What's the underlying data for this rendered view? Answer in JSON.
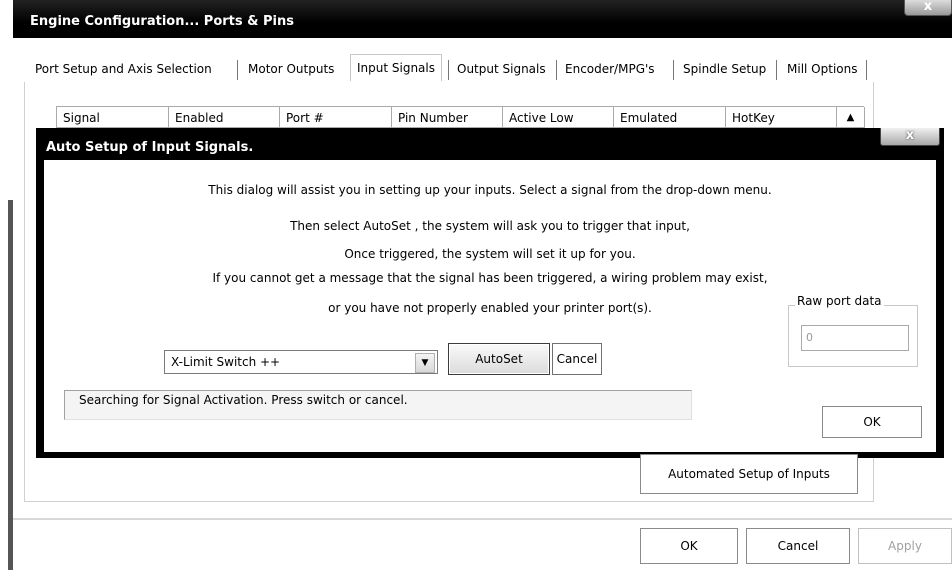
{
  "main_window": {
    "title": "Engine Configuration... Ports & Pins",
    "close_glyph": "x"
  },
  "tabs": [
    {
      "label": "Port Setup and Axis Selection"
    },
    {
      "label": "Motor Outputs"
    },
    {
      "label": "Input Signals",
      "selected": true
    },
    {
      "label": "Output Signals"
    },
    {
      "label": "Encoder/MPG's"
    },
    {
      "label": "Spindle Setup"
    },
    {
      "label": "Mill Options"
    }
  ],
  "table": {
    "columns": [
      "Signal",
      "Enabled",
      "Port #",
      "Pin Number",
      "Active Low",
      "Emulated",
      "HotKey"
    ],
    "scroll_glyph": "▲"
  },
  "dialog": {
    "title": "Auto Setup of Input Signals.",
    "close_glyph": "x",
    "messages": [
      "This dialog will assist you in setting up your inputs. Select a signal from the drop-down menu.",
      "Then select AutoSet , the system will ask you to trigger that input,",
      "Once triggered, the system will set it up for you.",
      "If you cannot get a message that the signal has been triggered, a wiring problem may exist,",
      "or you have not properly enabled your printer port(s)."
    ],
    "signal_select": {
      "value": "X-Limit Switch ++",
      "arrow": "▼"
    },
    "autoset_label": "AutoSet",
    "cancel_label": "Cancel",
    "status_text": "Searching for Signal Activation. Press switch or cancel.",
    "raw_port": {
      "label": "Raw port data",
      "value": "0"
    },
    "ok_label": "OK"
  },
  "footer": {
    "automated_setup_label": "Automated Setup of Inputs",
    "ok_label": "OK",
    "cancel_label": "Cancel",
    "apply_label": "Apply"
  }
}
